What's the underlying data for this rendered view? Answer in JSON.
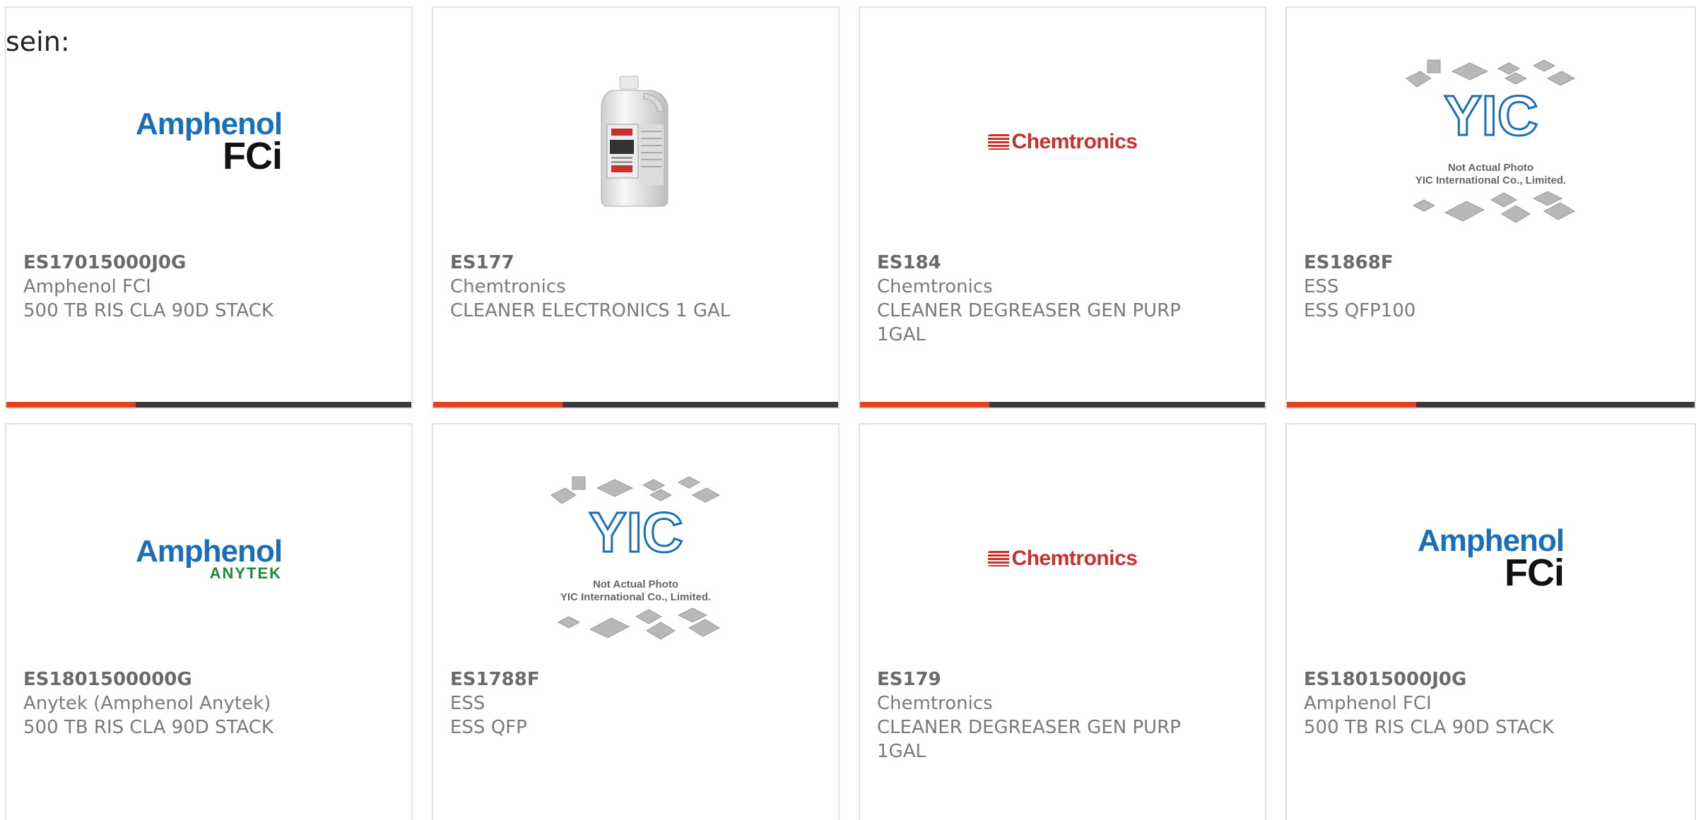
{
  "intro_text": "sein:",
  "colors": {
    "accent_bar": "#e8401c",
    "dark_bar": "#3a3a3a",
    "amphenol_blue": "#1a6fb8",
    "amphenol_dark": "#111111",
    "anytek_green": "#1e8a3c",
    "chemtronics_red": "#c9302c"
  },
  "logos": {
    "amphenol": "Amphenol",
    "fci": "FCi",
    "anytek": "ANYTEK",
    "chemtronics": "Chemtronics",
    "yic_mark": "YIC",
    "yic_line1": "Not Actual Photo",
    "yic_line2": "YIC International Co., Limited."
  },
  "products": [
    {
      "part": "ES17015000J0G",
      "manufacturer": "Amphenol FCI",
      "description": "500 TB RIS CLA 90D STACK",
      "image": "amphenol-fci-logo"
    },
    {
      "part": "ES177",
      "manufacturer": "Chemtronics",
      "description": "CLEANER ELECTRONICS 1 GAL",
      "image": "gallon-jug-photo"
    },
    {
      "part": "ES184",
      "manufacturer": "Chemtronics",
      "description": "CLEANER DEGREASER GEN PURP 1GAL",
      "image": "chemtronics-logo"
    },
    {
      "part": "ES1868F",
      "manufacturer": "ESS",
      "description": "ESS QFP100",
      "image": "yic-not-actual-photo"
    },
    {
      "part": "ES1801500000G",
      "manufacturer": "Anytek (Amphenol Anytek)",
      "description": "500 TB RIS CLA 90D STACK",
      "image": "amphenol-anytek-logo"
    },
    {
      "part": "ES1788F",
      "manufacturer": "ESS",
      "description": "ESS QFP",
      "image": "yic-not-actual-photo"
    },
    {
      "part": "ES179",
      "manufacturer": "Chemtronics",
      "description": "CLEANER DEGREASER GEN PURP 1GAL",
      "image": "chemtronics-logo"
    },
    {
      "part": "ES18015000J0G",
      "manufacturer": "Amphenol FCI",
      "description": "500 TB RIS CLA 90D STACK",
      "image": "amphenol-fci-logo"
    }
  ]
}
